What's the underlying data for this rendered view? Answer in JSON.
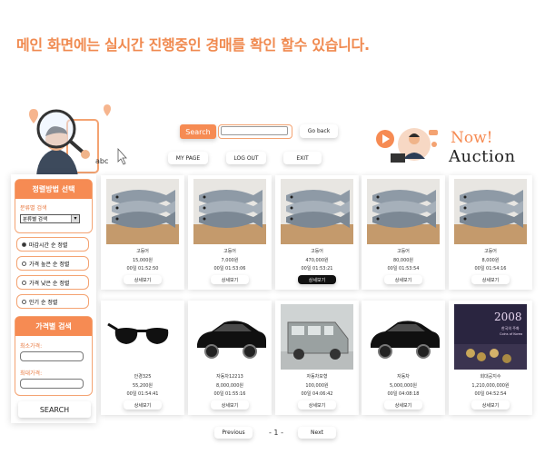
{
  "caption": "메인 화면에는 실시간 진행중인 경매를 확인 할수 있습니다.",
  "header": {
    "search_label": "Search",
    "search_value": "",
    "go_back": "Go back",
    "nav": [
      "MY PAGE",
      "LOG OUT",
      "EXIT"
    ],
    "mascot_text": "abc",
    "logo_line1": "Now!",
    "logo_line2": "Auction"
  },
  "sidebar": {
    "sort_title": "정렬방법 선택",
    "category_label": "분류별 검색",
    "category_selected": "분류별 검색",
    "sort_options": [
      {
        "label": "마감시간 순 정렬",
        "selected": true
      },
      {
        "label": "가격 높은 순 정렬",
        "selected": false
      },
      {
        "label": "가격 낮은 순 정렬",
        "selected": false
      },
      {
        "label": "인기 순 정렬",
        "selected": false
      }
    ],
    "price_title": "가격별 검색",
    "min_label": "최소가격:",
    "max_label": "최대가격:",
    "search_button": "SEARCH"
  },
  "items": [
    {
      "name": "고등어",
      "price": "15,000원",
      "time": "00일 01:52:50",
      "image": "fish",
      "detail": "상세보기",
      "detail_active": false
    },
    {
      "name": "고등어",
      "price": "7,000원",
      "time": "00일 01:53:06",
      "image": "fish",
      "detail": "상세보기",
      "detail_active": false
    },
    {
      "name": "고등어",
      "price": "470,000원",
      "time": "00일 01:53:21",
      "image": "fish",
      "detail": "상세보기",
      "detail_active": true
    },
    {
      "name": "고등어",
      "price": "80,000원",
      "time": "00일 01:53:54",
      "image": "fish",
      "detail": "상세보기",
      "detail_active": false
    },
    {
      "name": "고등어",
      "price": "8,000원",
      "time": "00일 01:54:16",
      "image": "fish",
      "detail": "상세보기",
      "detail_active": false
    },
    {
      "name": "안경325",
      "price": "55,200원",
      "time": "00일 01:54:41",
      "image": "glasses",
      "detail": "상세보기",
      "detail_active": false
    },
    {
      "name": "자동차12213",
      "price": "8,000,000원",
      "time": "00일 01:55:16",
      "image": "car",
      "detail": "상세보기",
      "detail_active": false
    },
    {
      "name": "자동차모형",
      "price": "100,000원",
      "time": "00일 04:06:42",
      "image": "van",
      "detail": "상세보기",
      "detail_active": false
    },
    {
      "name": "자동차",
      "price": "5,000,000원",
      "time": "00일 04:08:18",
      "image": "car",
      "detail": "상세보기",
      "detail_active": false
    },
    {
      "name": "회대공지수",
      "price": "1,210,000,000원",
      "time": "00일 04:52:54",
      "image": "poster",
      "detail": "상세보기",
      "detail_active": false
    }
  ],
  "poster_text": {
    "year": "2008",
    "sub": "한국의 주화",
    "sub2": "Coins of Korea"
  },
  "pagination": {
    "previous": "Previous",
    "page": "- 1 -",
    "next": "Next"
  },
  "colors": {
    "accent": "#f68b53",
    "accent_light": "#f4a372",
    "caption": "#f08a50",
    "dark_button": "#111111"
  }
}
